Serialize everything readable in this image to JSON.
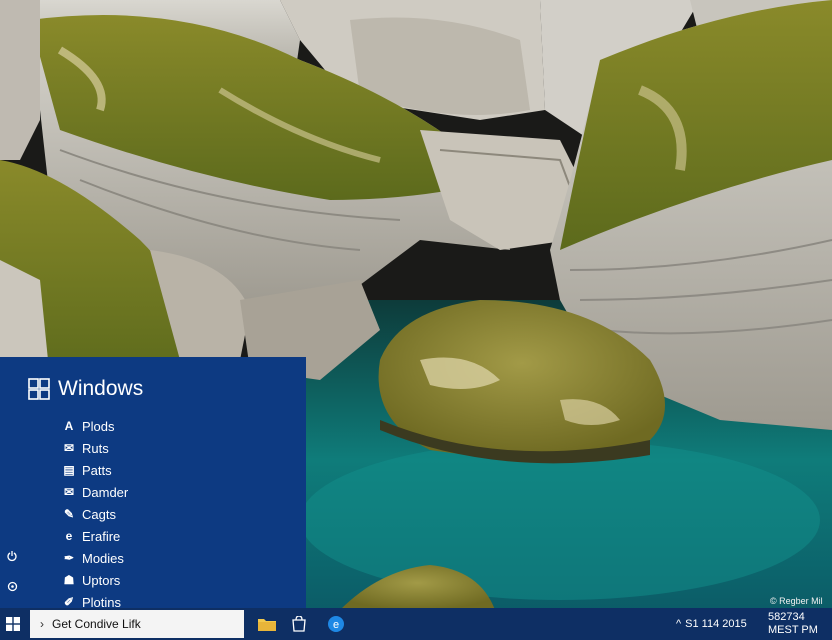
{
  "start_menu": {
    "brand": "Windows",
    "items": [
      {
        "label": "Plods",
        "icon": "letter-a-icon",
        "glyph": "A"
      },
      {
        "label": "Ruts",
        "icon": "mail-icon",
        "glyph": "✉"
      },
      {
        "label": "Patts",
        "icon": "document-icon",
        "glyph": "▤"
      },
      {
        "label": "Damder",
        "icon": "mail-icon",
        "glyph": "✉"
      },
      {
        "label": "Cagts",
        "icon": "brush-icon",
        "glyph": "✎"
      },
      {
        "label": "Erafire",
        "icon": "edge-icon",
        "glyph": "e"
      },
      {
        "label": "Modies",
        "icon": "quill-icon",
        "glyph": "✒"
      },
      {
        "label": "Uptors",
        "icon": "people-icon",
        "glyph": "☗"
      },
      {
        "label": "Plotins",
        "icon": "pen-icon",
        "glyph": "✐"
      }
    ],
    "side_icons": [
      "power-icon",
      "settings-icon"
    ]
  },
  "taskbar": {
    "search_text": "Get Condive Lifk",
    "pinned": [
      "file-explorer-icon",
      "store-icon",
      "browser-icon"
    ],
    "tray_text": "S1 114 2015",
    "clock_line1": "582734",
    "clock_line2": "MEST PM",
    "watermark": "© Regber Mil"
  },
  "colors": {
    "start_menu_bg": "#0d3a82",
    "taskbar_bg": "#0e2f64",
    "accent": "#0078d7"
  }
}
